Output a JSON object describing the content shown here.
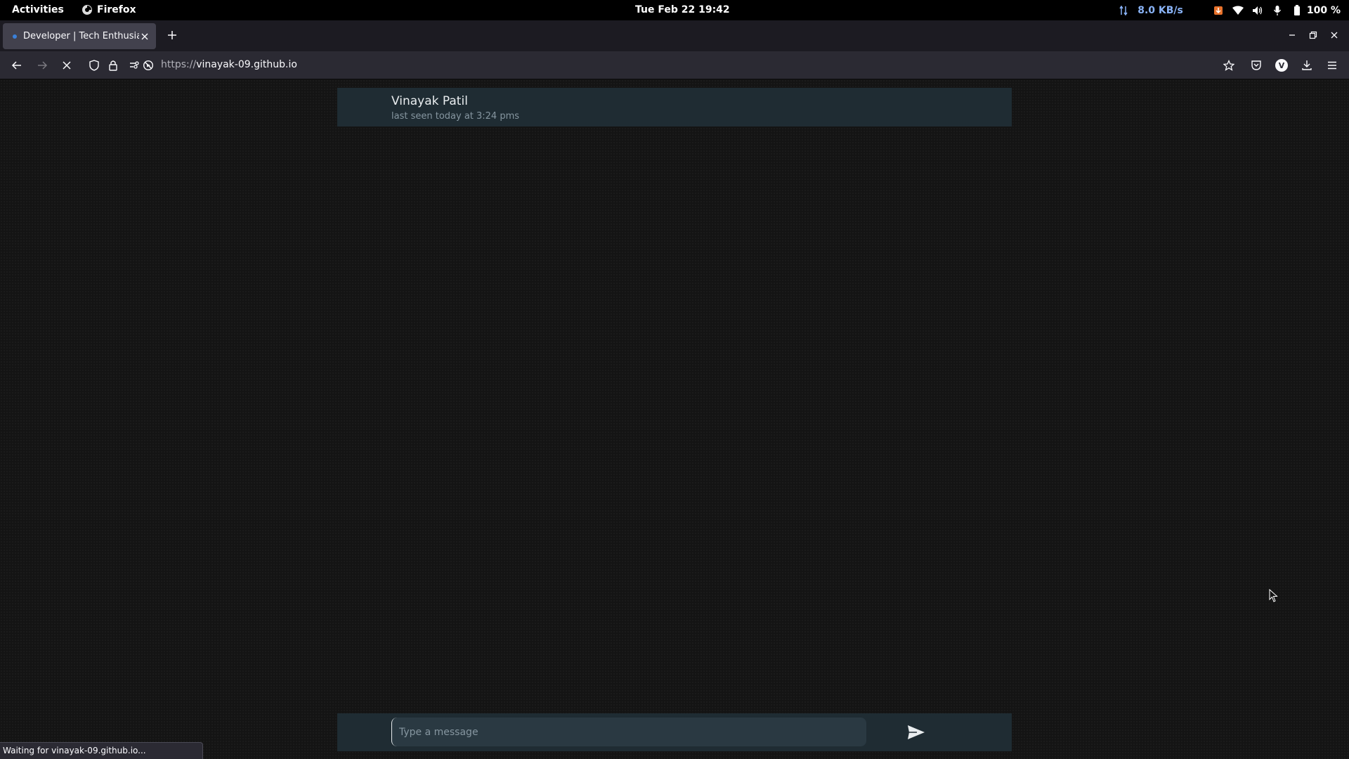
{
  "system_bar": {
    "activities": "Activities",
    "app_name": "Firefox",
    "clock": "Tue Feb 22  19:42",
    "net_speed": "8.0 KB/s",
    "battery": "100 %"
  },
  "browser": {
    "tab_title": "Developer | Tech Enthusiast",
    "url_protocol": "https://",
    "url_host": "vinayak-09.github.io",
    "status_text": "Waiting for vinayak-09.github.io..."
  },
  "chat": {
    "contact_name": "Vinayak Patil",
    "last_seen": "last seen today at 3:24 pms",
    "message_placeholder": "Type a message"
  },
  "colors": {
    "page_background": "#141414",
    "panel_background": "#1f2c33",
    "input_background": "#2a3942",
    "primary_text": "#e9edef",
    "secondary_text": "#8696a0"
  }
}
